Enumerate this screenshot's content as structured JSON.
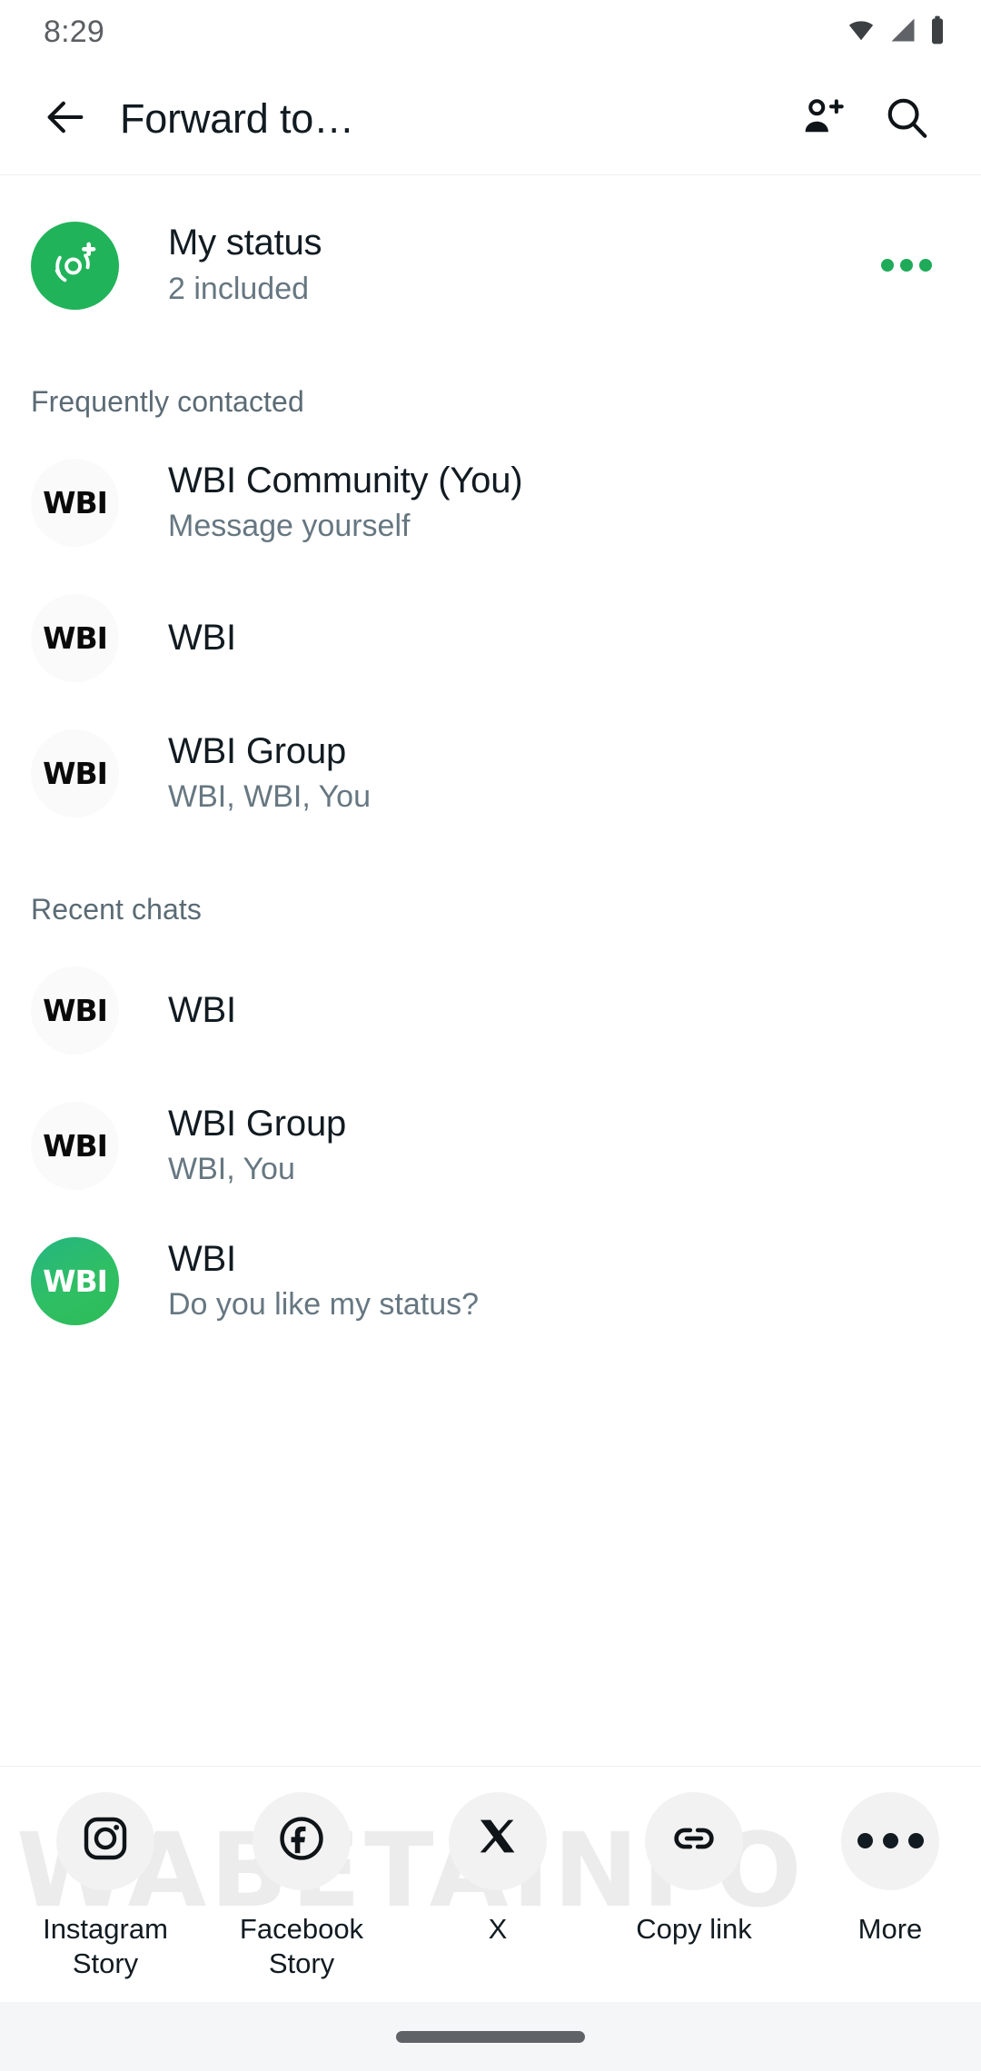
{
  "status_bar": {
    "time": "8:29",
    "icons": [
      "wifi-icon",
      "cellular-signal-icon",
      "battery-icon"
    ]
  },
  "app_bar": {
    "back_icon": "arrow-back-icon",
    "title": "Forward to…",
    "actions": [
      {
        "icon": "add-person-icon",
        "name": "new-contact-button"
      },
      {
        "icon": "search-icon",
        "name": "search-button"
      }
    ]
  },
  "my_status": {
    "avatar_icon": "status-camera-plus-icon",
    "avatar_color": "#21b35a",
    "title": "My status",
    "subtitle": "2 included",
    "overflow_icon": "more-options-icon",
    "overflow_color": "#1faa59"
  },
  "sections": [
    {
      "header": "Frequently contacted",
      "items": [
        {
          "avatar_text": "WBI",
          "avatar_style": "light",
          "title": "WBI Community (You)",
          "subtitle": "Message yourself"
        },
        {
          "avatar_text": "WBI",
          "avatar_style": "light",
          "title": "WBI",
          "subtitle": ""
        },
        {
          "avatar_text": "WBI",
          "avatar_style": "light",
          "title": "WBI Group",
          "subtitle": "WBI, WBI, You"
        }
      ]
    },
    {
      "header": "Recent chats",
      "items": [
        {
          "avatar_text": "WBI",
          "avatar_style": "light",
          "title": "WBI",
          "subtitle": ""
        },
        {
          "avatar_text": "WBI",
          "avatar_style": "light",
          "title": "WBI Group",
          "subtitle": "WBI, You"
        },
        {
          "avatar_text": "WBI",
          "avatar_style": "green",
          "title": "WBI",
          "subtitle": "Do you like my status?"
        }
      ]
    }
  ],
  "share_sheet": {
    "watermark": "WABETAINFO",
    "items": [
      {
        "icon": "instagram-icon",
        "label": "Instagram\nStory"
      },
      {
        "icon": "facebook-icon",
        "label": "Facebook\nStory"
      },
      {
        "icon": "x-twitter-icon",
        "label": "X"
      },
      {
        "icon": "link-icon",
        "label": "Copy link"
      },
      {
        "icon": "more-horizontal-icon",
        "label": "More"
      }
    ]
  },
  "nav_bar": {
    "handle": "gesture-home-pill"
  }
}
